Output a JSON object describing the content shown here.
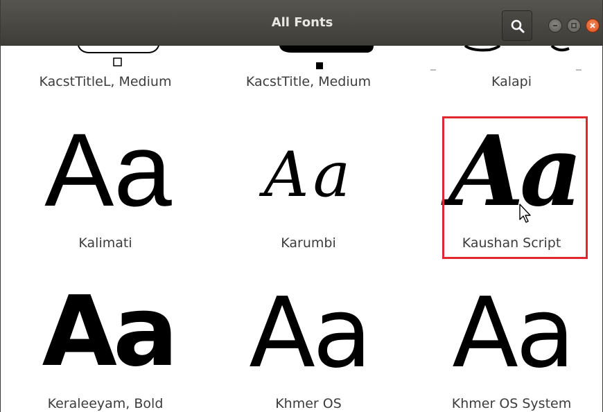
{
  "window": {
    "title": "All Fonts",
    "buttons": {
      "search": "search-icon",
      "minimize": "minimize-icon",
      "maximize": "maximize-icon",
      "close": "close-icon"
    },
    "colors": {
      "titlebar": "#4a4843",
      "close": "#e5531f",
      "selection": "#e2282f"
    }
  },
  "grid": {
    "row1": [
      "KacstTitleL, Medium",
      "KacstTitle, Medium",
      "Kalapi"
    ],
    "row2": [
      "Kalimati",
      "Karumbi",
      "Kaushan Script"
    ],
    "row3": [
      "Keraleeyam, Bold",
      "Khmer OS",
      "Khmer OS System"
    ],
    "sample_text": "Aa",
    "selected": "Kaushan Script"
  }
}
